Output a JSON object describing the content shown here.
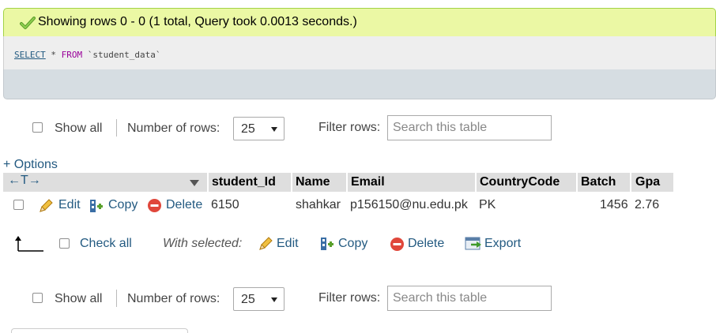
{
  "success": {
    "message": "Showing rows 0 - 0 (1 total, Query took 0.0013 seconds.)",
    "icon": "check-icon"
  },
  "sql": {
    "select": "SELECT",
    "star": " * ",
    "from": "FROM",
    "table": " `student_data`"
  },
  "nav_top": {
    "show_all": "Show all",
    "num_rows_label": "Number of rows:",
    "num_rows_value": "25",
    "filter_label": "Filter rows:",
    "search_placeholder": "Search this table"
  },
  "options_link": "+ Options",
  "table": {
    "col_arrows": "←T→",
    "columns": [
      "student_Id",
      "Name",
      "Email",
      "CountryCode",
      "Batch",
      "Gpa"
    ],
    "row": {
      "edit": "Edit",
      "copy": "Copy",
      "delete": "Delete",
      "cells": [
        "6150",
        "shahkar",
        "p156150@nu.edu.pk",
        "PK",
        "1456",
        "2.76"
      ]
    }
  },
  "with_selected": {
    "check_all": "Check all",
    "label": "With selected:",
    "edit": "Edit",
    "copy": "Copy",
    "delete": "Delete",
    "export": "Export"
  },
  "nav_bottom": {
    "show_all": "Show all",
    "num_rows_label": "Number of rows:",
    "num_rows_value": "25",
    "filter_label": "Filter rows:",
    "search_placeholder": "Search this table"
  },
  "colors": {
    "success_bg": "#ebf8a4",
    "link": "#235a81",
    "header_bg": "#dedede",
    "keyword": "#990099"
  }
}
